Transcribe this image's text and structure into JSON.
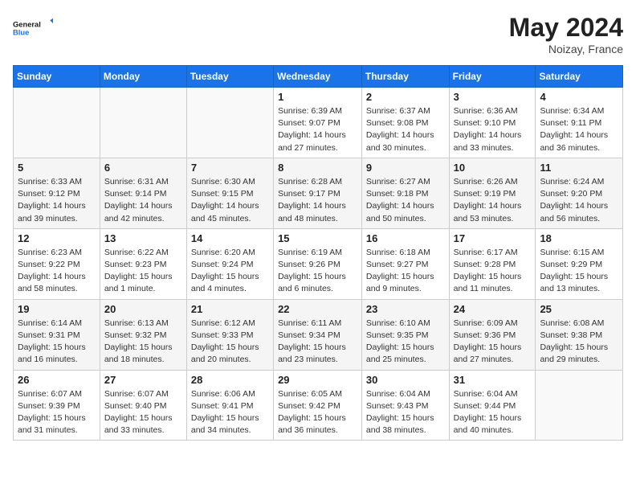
{
  "logo": {
    "text_general": "General",
    "text_blue": "Blue"
  },
  "header": {
    "month_year": "May 2024",
    "location": "Noizay, France"
  },
  "days_of_week": [
    "Sunday",
    "Monday",
    "Tuesday",
    "Wednesday",
    "Thursday",
    "Friday",
    "Saturday"
  ],
  "weeks": [
    [
      {
        "day": "",
        "info": ""
      },
      {
        "day": "",
        "info": ""
      },
      {
        "day": "",
        "info": ""
      },
      {
        "day": "1",
        "info": "Sunrise: 6:39 AM\nSunset: 9:07 PM\nDaylight: 14 hours and 27 minutes."
      },
      {
        "day": "2",
        "info": "Sunrise: 6:37 AM\nSunset: 9:08 PM\nDaylight: 14 hours and 30 minutes."
      },
      {
        "day": "3",
        "info": "Sunrise: 6:36 AM\nSunset: 9:10 PM\nDaylight: 14 hours and 33 minutes."
      },
      {
        "day": "4",
        "info": "Sunrise: 6:34 AM\nSunset: 9:11 PM\nDaylight: 14 hours and 36 minutes."
      }
    ],
    [
      {
        "day": "5",
        "info": "Sunrise: 6:33 AM\nSunset: 9:12 PM\nDaylight: 14 hours and 39 minutes."
      },
      {
        "day": "6",
        "info": "Sunrise: 6:31 AM\nSunset: 9:14 PM\nDaylight: 14 hours and 42 minutes."
      },
      {
        "day": "7",
        "info": "Sunrise: 6:30 AM\nSunset: 9:15 PM\nDaylight: 14 hours and 45 minutes."
      },
      {
        "day": "8",
        "info": "Sunrise: 6:28 AM\nSunset: 9:17 PM\nDaylight: 14 hours and 48 minutes."
      },
      {
        "day": "9",
        "info": "Sunrise: 6:27 AM\nSunset: 9:18 PM\nDaylight: 14 hours and 50 minutes."
      },
      {
        "day": "10",
        "info": "Sunrise: 6:26 AM\nSunset: 9:19 PM\nDaylight: 14 hours and 53 minutes."
      },
      {
        "day": "11",
        "info": "Sunrise: 6:24 AM\nSunset: 9:20 PM\nDaylight: 14 hours and 56 minutes."
      }
    ],
    [
      {
        "day": "12",
        "info": "Sunrise: 6:23 AM\nSunset: 9:22 PM\nDaylight: 14 hours and 58 minutes."
      },
      {
        "day": "13",
        "info": "Sunrise: 6:22 AM\nSunset: 9:23 PM\nDaylight: 15 hours and 1 minute."
      },
      {
        "day": "14",
        "info": "Sunrise: 6:20 AM\nSunset: 9:24 PM\nDaylight: 15 hours and 4 minutes."
      },
      {
        "day": "15",
        "info": "Sunrise: 6:19 AM\nSunset: 9:26 PM\nDaylight: 15 hours and 6 minutes."
      },
      {
        "day": "16",
        "info": "Sunrise: 6:18 AM\nSunset: 9:27 PM\nDaylight: 15 hours and 9 minutes."
      },
      {
        "day": "17",
        "info": "Sunrise: 6:17 AM\nSunset: 9:28 PM\nDaylight: 15 hours and 11 minutes."
      },
      {
        "day": "18",
        "info": "Sunrise: 6:15 AM\nSunset: 9:29 PM\nDaylight: 15 hours and 13 minutes."
      }
    ],
    [
      {
        "day": "19",
        "info": "Sunrise: 6:14 AM\nSunset: 9:31 PM\nDaylight: 15 hours and 16 minutes."
      },
      {
        "day": "20",
        "info": "Sunrise: 6:13 AM\nSunset: 9:32 PM\nDaylight: 15 hours and 18 minutes."
      },
      {
        "day": "21",
        "info": "Sunrise: 6:12 AM\nSunset: 9:33 PM\nDaylight: 15 hours and 20 minutes."
      },
      {
        "day": "22",
        "info": "Sunrise: 6:11 AM\nSunset: 9:34 PM\nDaylight: 15 hours and 23 minutes."
      },
      {
        "day": "23",
        "info": "Sunrise: 6:10 AM\nSunset: 9:35 PM\nDaylight: 15 hours and 25 minutes."
      },
      {
        "day": "24",
        "info": "Sunrise: 6:09 AM\nSunset: 9:36 PM\nDaylight: 15 hours and 27 minutes."
      },
      {
        "day": "25",
        "info": "Sunrise: 6:08 AM\nSunset: 9:38 PM\nDaylight: 15 hours and 29 minutes."
      }
    ],
    [
      {
        "day": "26",
        "info": "Sunrise: 6:07 AM\nSunset: 9:39 PM\nDaylight: 15 hours and 31 minutes."
      },
      {
        "day": "27",
        "info": "Sunrise: 6:07 AM\nSunset: 9:40 PM\nDaylight: 15 hours and 33 minutes."
      },
      {
        "day": "28",
        "info": "Sunrise: 6:06 AM\nSunset: 9:41 PM\nDaylight: 15 hours and 34 minutes."
      },
      {
        "day": "29",
        "info": "Sunrise: 6:05 AM\nSunset: 9:42 PM\nDaylight: 15 hours and 36 minutes."
      },
      {
        "day": "30",
        "info": "Sunrise: 6:04 AM\nSunset: 9:43 PM\nDaylight: 15 hours and 38 minutes."
      },
      {
        "day": "31",
        "info": "Sunrise: 6:04 AM\nSunset: 9:44 PM\nDaylight: 15 hours and 40 minutes."
      },
      {
        "day": "",
        "info": ""
      }
    ]
  ]
}
